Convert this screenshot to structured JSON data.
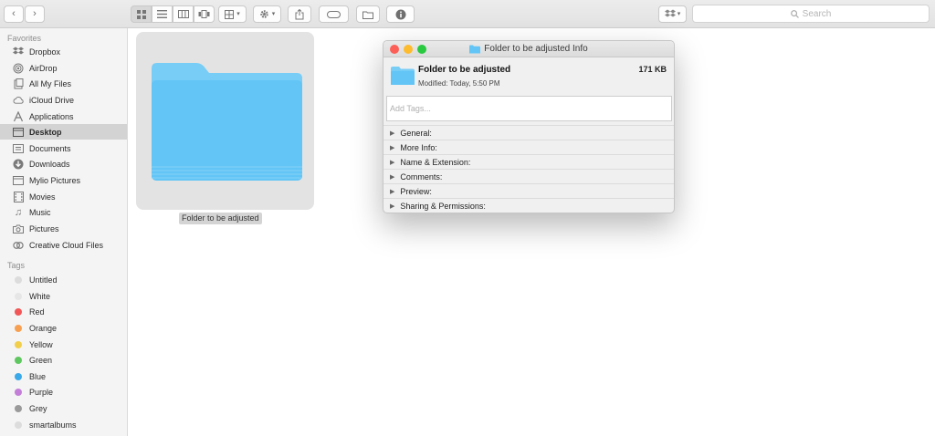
{
  "toolbar": {
    "nav": [
      {
        "name": "back-button",
        "glyph": "‹"
      },
      {
        "name": "forward-button",
        "glyph": "›"
      }
    ],
    "search_placeholder": "Search"
  },
  "sidebar": {
    "favorites_header": "Favorites",
    "favorites": [
      {
        "label": "Dropbox",
        "icon": "dropbox-icon"
      },
      {
        "label": "AirDrop",
        "icon": "airdrop-icon"
      },
      {
        "label": "All My Files",
        "icon": "all-files-icon"
      },
      {
        "label": "iCloud Drive",
        "icon": "cloud-icon"
      },
      {
        "label": "Applications",
        "icon": "applications-icon"
      },
      {
        "label": "Desktop",
        "icon": "desktop-icon",
        "selected": true
      },
      {
        "label": "Documents",
        "icon": "documents-icon"
      },
      {
        "label": "Downloads",
        "icon": "downloads-icon"
      },
      {
        "label": "Mylio Pictures",
        "icon": "mylio-icon"
      },
      {
        "label": "Movies",
        "icon": "movies-icon"
      },
      {
        "label": "Music",
        "icon": "music-icon"
      },
      {
        "label": "Pictures",
        "icon": "pictures-icon"
      },
      {
        "label": "Creative Cloud Files",
        "icon": "creative-cloud-icon"
      }
    ],
    "tags_header": "Tags",
    "tags": [
      {
        "label": "Untitled",
        "color": "#dcdcdc"
      },
      {
        "label": "White",
        "color": "#e6e6e6"
      },
      {
        "label": "Red",
        "color": "#f25656"
      },
      {
        "label": "Orange",
        "color": "#f7a052"
      },
      {
        "label": "Yellow",
        "color": "#f2cf4a"
      },
      {
        "label": "Green",
        "color": "#5fc75f"
      },
      {
        "label": "Blue",
        "color": "#3aa9ea"
      },
      {
        "label": "Purple",
        "color": "#c37fd8"
      },
      {
        "label": "Grey",
        "color": "#9a9a9a"
      },
      {
        "label": "smartalbums",
        "color": "#dcdcdc"
      }
    ]
  },
  "main": {
    "folder_label": "Folder to be adjusted"
  },
  "info_window": {
    "title": "Folder to be adjusted Info",
    "name": "Folder to be adjusted",
    "size": "171 KB",
    "modified": "Modified: Today, 5:50 PM",
    "tags_placeholder": "Add Tags...",
    "sections": [
      "General:",
      "More Info:",
      "Name & Extension:",
      "Comments:",
      "Preview:",
      "Sharing & Permissions:"
    ]
  },
  "colors": {
    "folder_blue": "#62c5f6",
    "close": "#fc5f57",
    "minimize": "#fdbb2e",
    "zoom": "#29c940"
  }
}
